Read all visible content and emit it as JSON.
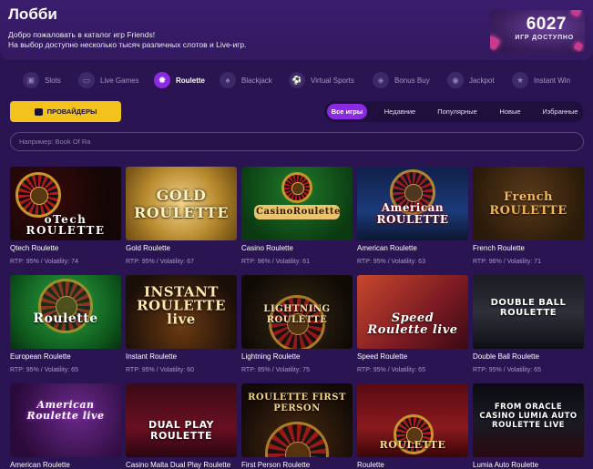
{
  "header": {
    "title": "Лобби",
    "subtitle_line1": "Добро пожаловать в каталог игр Friends!",
    "subtitle_line2": "На выбор доступно несколько тысяч различных слотов и Live-игр.",
    "counter_value": "6027",
    "counter_label": "ИГР ДОСТУПНО"
  },
  "categories": [
    {
      "label": "Slots",
      "icon": "slot-machine-icon"
    },
    {
      "label": "Live Games",
      "icon": "monitor-icon"
    },
    {
      "label": "Roulette",
      "icon": "roulette-icon"
    },
    {
      "label": "Blackjack",
      "icon": "cards-icon"
    },
    {
      "label": "Virtual Sports",
      "icon": "ball-icon"
    },
    {
      "label": "Bonus Buy",
      "icon": "bag-icon"
    },
    {
      "label": "Jackpot",
      "icon": "coins-icon"
    },
    {
      "label": "Instant Win",
      "icon": "trophy-icon"
    }
  ],
  "providers_label": "ПРОВАЙДЕРЫ",
  "filters": [
    "Все игры",
    "Недавние",
    "Популярные",
    "Новые",
    "Избранные"
  ],
  "search": {
    "placeholder": "Например: Book Of Ra"
  },
  "games": [
    {
      "name": "Qtech Roulette",
      "meta": "RTP: 95% / Volatility: 74",
      "logo": "oTech ROULETTE"
    },
    {
      "name": "Gold Roulette",
      "meta": "RTP: 95% / Volatility: 67",
      "logo": "GOLD ROULETTE"
    },
    {
      "name": "Casino Roulette",
      "meta": "RTP: 96% / Volatility: 61",
      "logo": "CasinoRoulette"
    },
    {
      "name": "American Roulette",
      "meta": "RTP: 95% / Volatility: 63",
      "logo": "American ROULETTE"
    },
    {
      "name": "French Roulette",
      "meta": "RTP: 96% / Volatility: 71",
      "logo": "French ROULETTE"
    },
    {
      "name": "European Roulette",
      "meta": "RTP: 95% / Volatility: 65",
      "logo": "Roulette"
    },
    {
      "name": "Instant Roulette",
      "meta": "RTP: 95% / Volatility: 60",
      "logo": "INSTANT ROULETTE live"
    },
    {
      "name": "Lightning Roulette",
      "meta": "RTP: 95% / Volatility: 75",
      "logo": "LIGHTNING ROULETTE"
    },
    {
      "name": "Speed Roulette",
      "meta": "RTP: 95% / Volatility: 65",
      "logo": "Speed Roulette live"
    },
    {
      "name": "Double Ball Roulette",
      "meta": "RTP: 95% / Volatility: 65",
      "logo": "DOUBLE BALL ROULETTE"
    },
    {
      "name": "American Roulette",
      "meta": "",
      "logo": "American Roulette live"
    },
    {
      "name": "Casino Malta Dual Play Roulette",
      "meta": "",
      "logo": "DUAL PLAY ROULETTE"
    },
    {
      "name": "First Person Roulette",
      "meta": "",
      "logo": "ROULETTE FIRST PERSON"
    },
    {
      "name": "Roulette",
      "meta": "",
      "logo": "ROULETTE"
    },
    {
      "name": "Lumia Auto Roulette",
      "meta": "",
      "logo": "FROM ORACLE CASINO LUMIA AUTO ROULETTE LIVE"
    }
  ],
  "colors": {
    "background": "#2a1552",
    "accent_purple": "#8a2be2",
    "accent_yellow": "#f4c21c"
  }
}
